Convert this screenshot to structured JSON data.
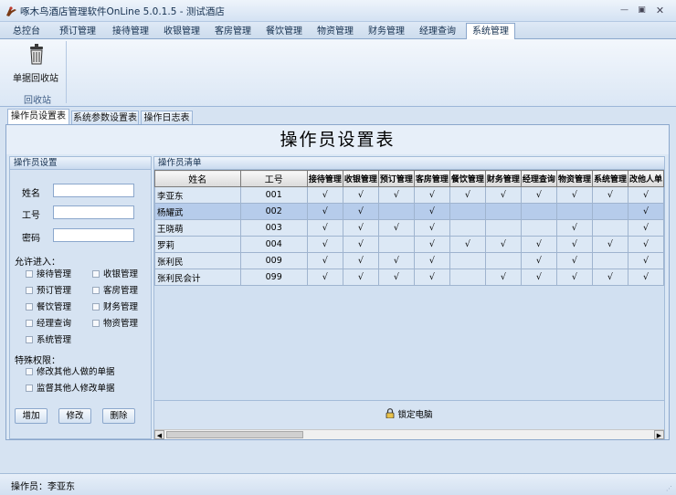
{
  "window": {
    "title": "啄木鸟酒店管理软件OnLine 5.0.1.5 - 测试酒店"
  },
  "menu_tabs": [
    "总控台",
    "预订管理",
    "接待管理",
    "收银管理",
    "客房管理",
    "餐饮管理",
    "物资管理",
    "财务管理",
    "经理查询",
    "系统管理"
  ],
  "active_menu": "系统管理",
  "ribbon": {
    "button_label": "单据回收站",
    "group_label": "回收站"
  },
  "sub_tabs": [
    "操作员设置表",
    "系统参数设置表",
    "操作日志表"
  ],
  "heading": "操作员设置表",
  "operator_panel": {
    "title": "操作员设置",
    "name_label": "姓名",
    "id_label": "工号",
    "password_label": "密码",
    "name_value": "",
    "id_value": "",
    "password_value": "",
    "allow_label": "允许进入：",
    "permissions": [
      "接待管理",
      "收银管理",
      "预订管理",
      "客房管理",
      "餐饮管理",
      "财务管理",
      "经理查询",
      "物资管理",
      "系统管理"
    ],
    "special_label": "特殊权限：",
    "special_permissions": [
      "修改其他人做的单据",
      "监督其他人修改单据"
    ],
    "buttons": {
      "add": "增加",
      "edit": "修改",
      "delete": "删除"
    }
  },
  "list_panel": {
    "title": "操作员清单",
    "columns": [
      "姓名",
      "工号",
      "接待管理",
      "收银管理",
      "预订管理",
      "客房管理",
      "餐饮管理",
      "财务管理",
      "经理查询",
      "物资管理",
      "系统管理",
      "改他人单"
    ],
    "rows": [
      {
        "name": "李亚东",
        "id": "001",
        "marks": [
          "√",
          "√",
          "√",
          "√",
          "√",
          "√",
          "√",
          "√",
          "√",
          "√"
        ],
        "selected": false
      },
      {
        "name": "杨耀武",
        "id": "002",
        "marks": [
          "√",
          "√",
          "",
          "√",
          "",
          "",
          "",
          "",
          "",
          "√"
        ],
        "selected": true
      },
      {
        "name": "王晓萌",
        "id": "003",
        "marks": [
          "√",
          "√",
          "√",
          "√",
          "",
          "",
          "",
          "√",
          "",
          "√"
        ],
        "selected": false
      },
      {
        "name": "罗莉",
        "id": "004",
        "marks": [
          "√",
          "√",
          "",
          "√",
          "√",
          "√",
          "√",
          "√",
          "√",
          "√"
        ],
        "selected": false
      },
      {
        "name": "张利民",
        "id": "009",
        "marks": [
          "√",
          "√",
          "√",
          "√",
          "",
          "",
          "√",
          "√",
          "",
          "√"
        ],
        "selected": false
      },
      {
        "name": "张利民会计",
        "id": "099",
        "marks": [
          "√",
          "√",
          "√",
          "√",
          "",
          "√",
          "√",
          "√",
          "√",
          "√"
        ],
        "selected": false
      }
    ],
    "lock_label": "锁定电脑"
  },
  "status": {
    "operator": "操作员：李亚东"
  }
}
